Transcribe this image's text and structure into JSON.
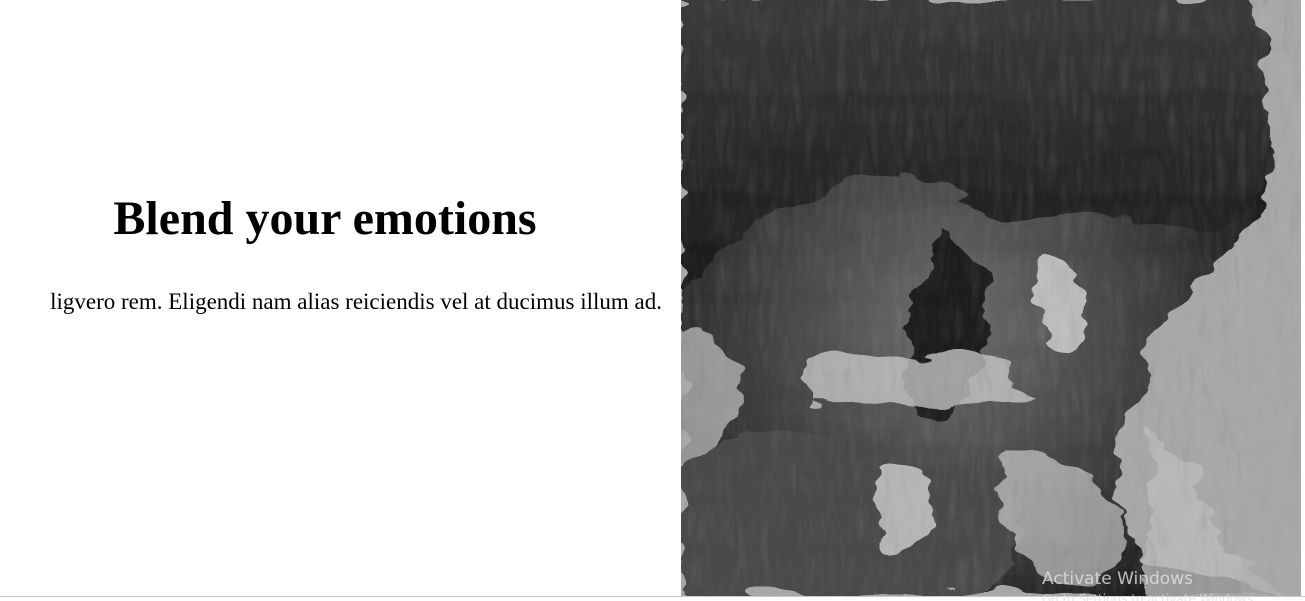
{
  "hero": {
    "title": "Blend your emotions",
    "paragraph": "ligvero rem. Eligendi nam alias reiciendis vel at ducimus illum ad."
  },
  "image": {
    "alt": "Abstract liquified grayscale portrait of a face",
    "style": "grayscale liquify distortion",
    "background_color": "#a9a9a9"
  },
  "system_overlay": {
    "watermark_title": "Activate Windows",
    "watermark_subtitle": "Go to Settings to activate Windows."
  },
  "colors": {
    "page_background": "#ffffff",
    "text": "#000000"
  }
}
